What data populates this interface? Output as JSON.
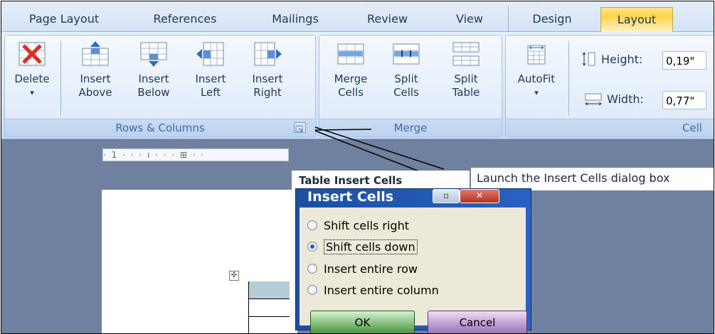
{
  "tabs": [
    "Page Layout",
    "References",
    "Mailings",
    "Review",
    "View",
    "Design",
    "Layout"
  ],
  "active_tab": "Layout",
  "ribbon": {
    "rows_columns": {
      "label": "Rows & Columns",
      "buttons": [
        {
          "l1": "Delete",
          "l2": "▾",
          "icon": "delete-table-icon"
        },
        {
          "l1": "Insert",
          "l2": "Above",
          "icon": "insert-above-icon"
        },
        {
          "l1": "Insert",
          "l2": "Below",
          "icon": "insert-below-icon"
        },
        {
          "l1": "Insert",
          "l2": "Left",
          "icon": "insert-left-icon"
        },
        {
          "l1": "Insert",
          "l2": "Right",
          "icon": "insert-right-icon"
        }
      ]
    },
    "merge": {
      "label": "Merge",
      "buttons": [
        {
          "l1": "Merge",
          "l2": "Cells",
          "icon": "merge-cells-icon"
        },
        {
          "l1": "Split",
          "l2": "Cells",
          "icon": "split-cells-icon"
        },
        {
          "l1": "Split",
          "l2": "Table",
          "icon": "split-table-icon"
        }
      ]
    },
    "cell_size": {
      "label": "Cell",
      "autofit": {
        "l1": "AutoFit",
        "l2": "▾"
      },
      "height_label": "Height:",
      "height_value": "0,19\"",
      "width_label": "Width:",
      "width_value": "0,77\""
    }
  },
  "ruler_text": "· 1 · · · ı · · · ⊞ · ·",
  "tooltip": {
    "title": "Table Insert Cells",
    "description": "Launch the Insert Cells dialog box"
  },
  "dialog": {
    "title": "Insert Cells",
    "min_glyph": "▫",
    "close_glyph": "✕",
    "options": [
      {
        "label": "Shift cells right",
        "selected": false
      },
      {
        "label": "Shift cells down",
        "selected": true
      },
      {
        "label": "Insert entire row",
        "selected": false
      },
      {
        "label": "Insert entire column",
        "selected": false
      }
    ],
    "ok": "OK",
    "cancel": "Cancel"
  },
  "colors": {
    "accent": "#ffd44a",
    "ribbon": "#d4e3f6",
    "dialog_title": "#2a62c2"
  }
}
